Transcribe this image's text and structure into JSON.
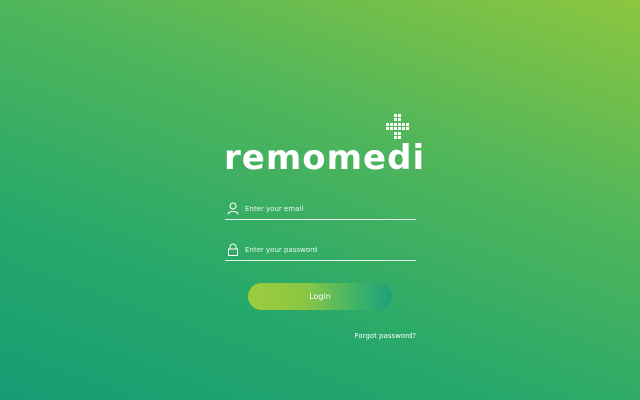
{
  "logo": {
    "text": "remomedi",
    "icon": "pixel-cross-icon"
  },
  "form": {
    "email": {
      "placeholder": "Enter your email",
      "value": "",
      "icon": "user-icon"
    },
    "password": {
      "placeholder": "Enter your password",
      "value": "",
      "icon": "lock-icon"
    },
    "login_label": "Login",
    "forgot_label": "Forgot password?"
  },
  "colors": {
    "background_light": "#8cc63f",
    "background_dark": "#159c74",
    "button_start": "#9ccc3c",
    "button_end": "#1f9f7a",
    "text": "#ffffff"
  }
}
